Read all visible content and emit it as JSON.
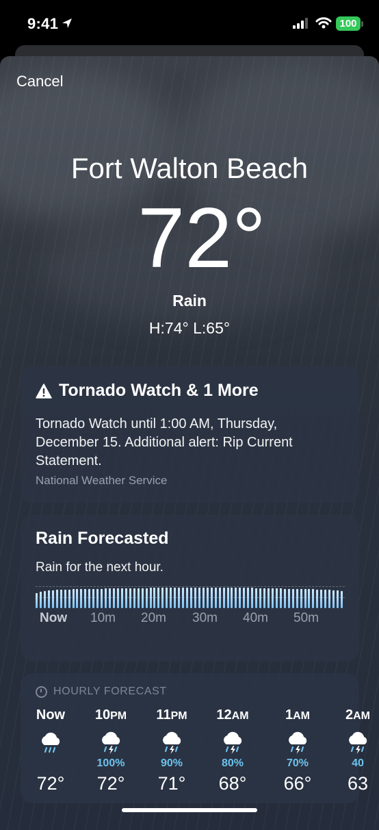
{
  "status_bar": {
    "time": "9:41",
    "battery": "100",
    "battery_color": "#34c759"
  },
  "nav": {
    "cancel_label": "Cancel"
  },
  "weather": {
    "city": "Fort Walton Beach",
    "temperature": "72°",
    "condition": "Rain",
    "high_low": "H:74°  L:65°"
  },
  "alert": {
    "icon": "warning-icon",
    "title": "Tornado Watch & 1 More",
    "body": "Tornado Watch until 1:00 AM, Thursday, December 15. Additional alert: Rip Current Statement.",
    "source": "National Weather Service"
  },
  "rain_forecast": {
    "title": "Rain Forecasted",
    "subtitle": "Rain for the next hour.",
    "time_labels": [
      "Now",
      "10m",
      "20m",
      "30m",
      "40m",
      "50m"
    ],
    "intensity": [
      0.62,
      0.66,
      0.69,
      0.71,
      0.73,
      0.74,
      0.75,
      0.76,
      0.76,
      0.77,
      0.77,
      0.78,
      0.78,
      0.78,
      0.79,
      0.79,
      0.79,
      0.8,
      0.8,
      0.8,
      0.8,
      0.8,
      0.81,
      0.81,
      0.81,
      0.81,
      0.81,
      0.81,
      0.82,
      0.82,
      0.82,
      0.82,
      0.82,
      0.82,
      0.82,
      0.83,
      0.83,
      0.83,
      0.83,
      0.83,
      0.83,
      0.83,
      0.83,
      0.83,
      0.83,
      0.83,
      0.83,
      0.83,
      0.83,
      0.82,
      0.82,
      0.82,
      0.82,
      0.82,
      0.81,
      0.81,
      0.81,
      0.8,
      0.8,
      0.8,
      0.8,
      0.79,
      0.79,
      0.79,
      0.78,
      0.78,
      0.78,
      0.77,
      0.77,
      0.76,
      0.76,
      0.75,
      0.74,
      0.73,
      0.72,
      0.7
    ],
    "bar_color": "#8ccaf5"
  },
  "hourly": {
    "header": "HOURLY FORECAST",
    "items": [
      {
        "hour": "Now",
        "suffix": "",
        "icon": "rain-cloud-icon",
        "precip": "",
        "temp": "72°"
      },
      {
        "hour": "10",
        "suffix": "PM",
        "icon": "thunderstorm-icon",
        "precip": "100%",
        "temp": "72°"
      },
      {
        "hour": "11",
        "suffix": "PM",
        "icon": "thunderstorm-icon",
        "precip": "90%",
        "temp": "71°"
      },
      {
        "hour": "12",
        "suffix": "AM",
        "icon": "thunderstorm-icon",
        "precip": "80%",
        "temp": "68°"
      },
      {
        "hour": "1",
        "suffix": "AM",
        "icon": "thunderstorm-icon",
        "precip": "70%",
        "temp": "66°"
      },
      {
        "hour": "2",
        "suffix": "AM",
        "icon": "thunderstorm-icon",
        "precip": "40",
        "temp": "63"
      }
    ],
    "precip_color": "#6cc3ee"
  }
}
